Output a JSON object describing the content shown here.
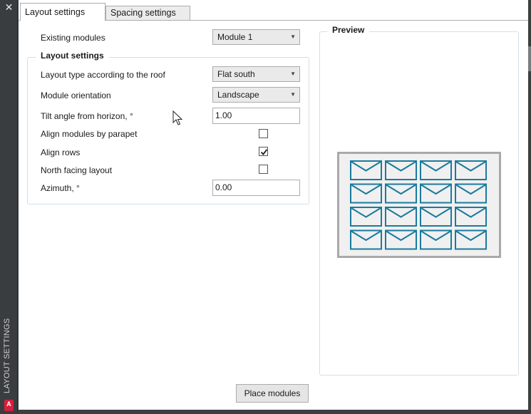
{
  "panel": {
    "side_title": "LAYOUT SETTINGS",
    "close_glyph": "✕",
    "app_badge": "A"
  },
  "tabs": [
    {
      "label": "Layout settings",
      "active": true
    },
    {
      "label": "Spacing settings",
      "active": false
    }
  ],
  "form": {
    "existing_modules": {
      "label": "Existing modules",
      "value": "Module 1"
    },
    "group_title": "Layout settings",
    "layout_type": {
      "label": "Layout type according to the roof",
      "value": "Flat south"
    },
    "orientation": {
      "label": "Module orientation",
      "value": "Landscape"
    },
    "tilt": {
      "label": "Tilt angle from horizon, °",
      "value": "1.00"
    },
    "align_parapet": {
      "label": "Align modules by parapet",
      "checked": false
    },
    "align_rows": {
      "label": "Align rows",
      "checked": true
    },
    "north_facing": {
      "label": "North facing layout",
      "checked": false
    },
    "azimuth": {
      "label": "Azimuth, °",
      "value": "0.00"
    }
  },
  "preview": {
    "title": "Preview",
    "module_rows": 4,
    "module_cols": 4,
    "module_color": "#1b7a9e",
    "frame_color": "#a9a9a9",
    "fill_color": "#f0f0f0"
  },
  "actions": {
    "place_label": "Place modules"
  },
  "icons": {
    "dropdown": "chevron-down-icon",
    "check": "checkmark-icon",
    "close": "close-icon",
    "cursor": "mouse-pointer-icon"
  }
}
